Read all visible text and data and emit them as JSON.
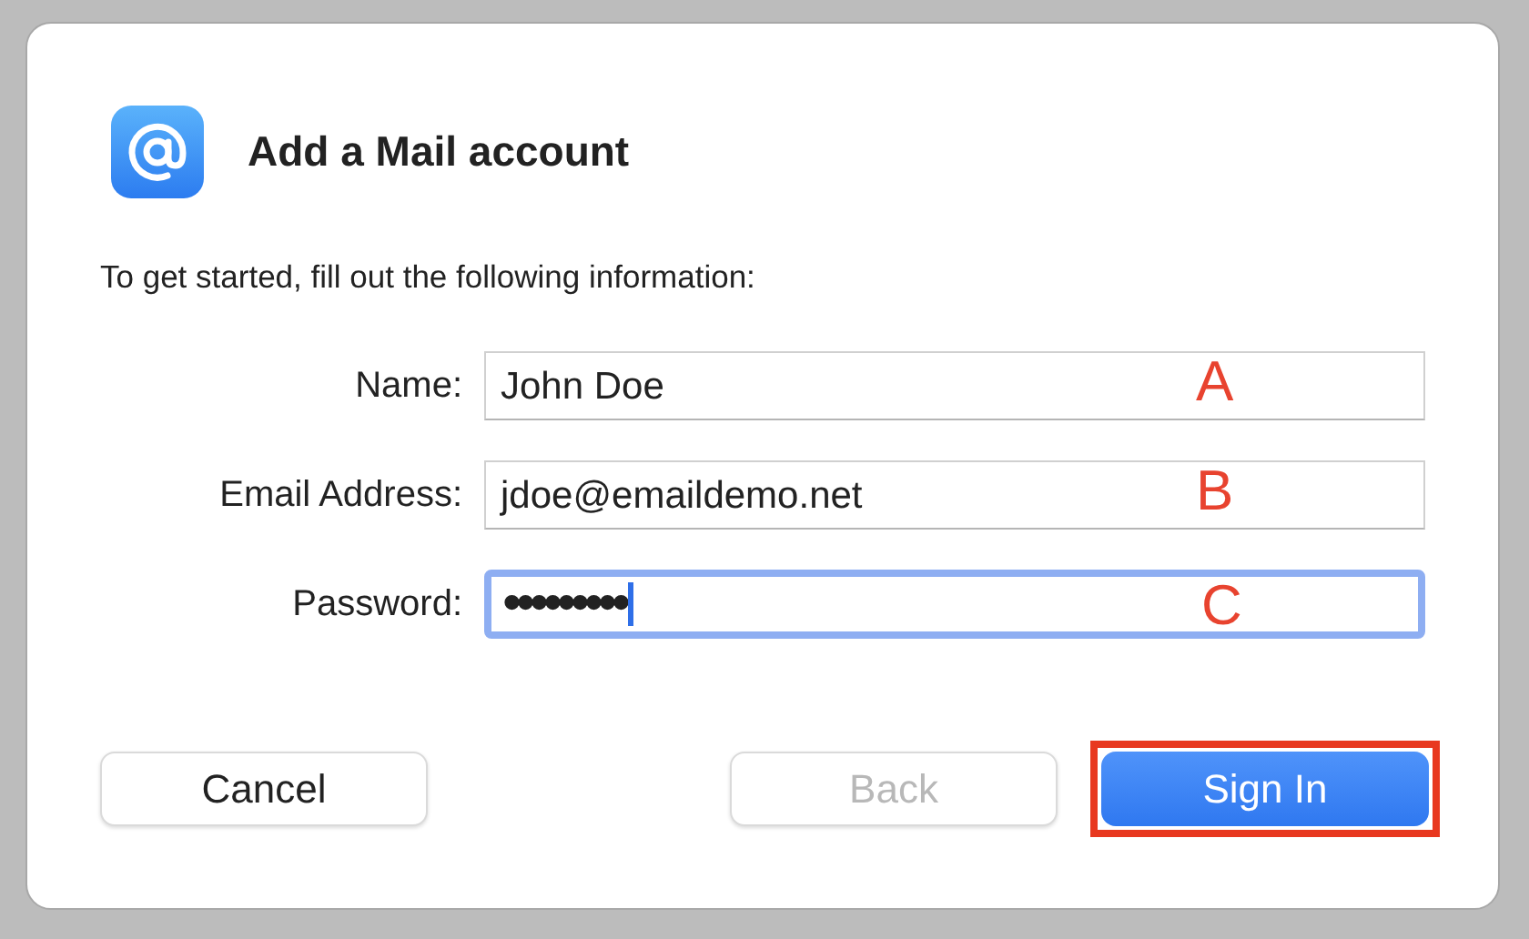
{
  "dialog": {
    "title": "Add a Mail account",
    "intro": "To get started, fill out the following information:"
  },
  "fields": [
    {
      "kind": "text",
      "label": "Name:",
      "value": "John Doe",
      "focused": false,
      "marker": "A"
    },
    {
      "kind": "text",
      "label": "Email Address:",
      "value": "jdoe@emaildemo.net",
      "focused": false,
      "marker": "B"
    },
    {
      "kind": "password",
      "label": "Password:",
      "value": "•••••••••",
      "focused": true,
      "marker": "C"
    }
  ],
  "buttons": [
    {
      "label": "Cancel",
      "kind": "normal",
      "disabled": false,
      "highlighted": false
    },
    {
      "label": "Back",
      "kind": "normal",
      "disabled": true,
      "highlighted": false
    },
    {
      "label": "Sign In",
      "kind": "default",
      "disabled": false,
      "highlighted": true
    }
  ]
}
